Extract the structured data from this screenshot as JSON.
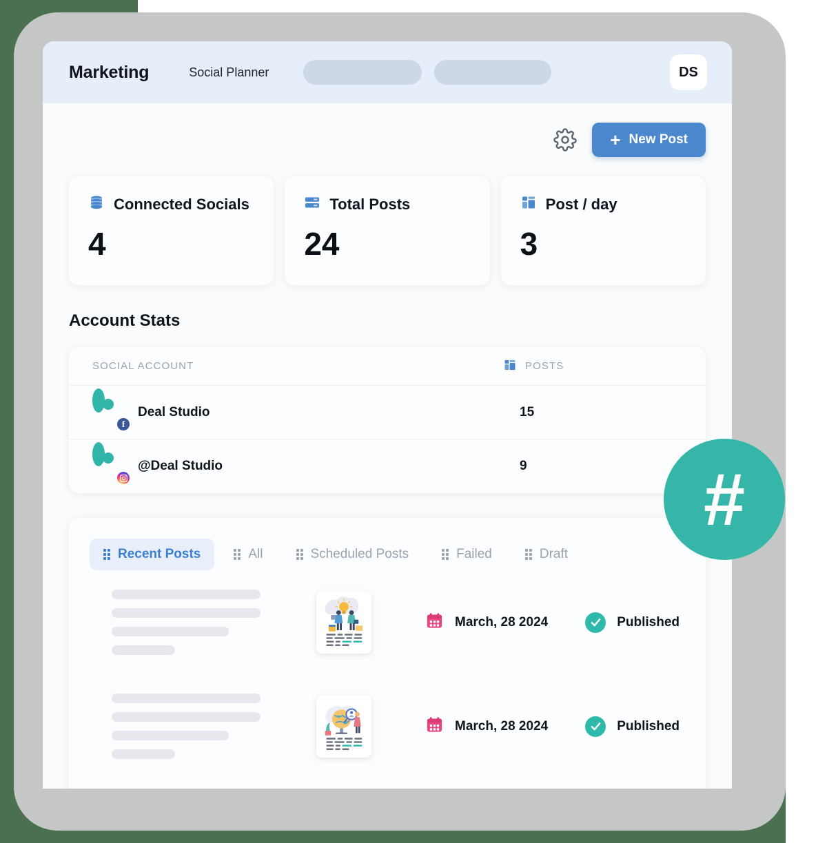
{
  "header": {
    "brand": "Marketing",
    "subtitle": "Social Planner",
    "avatar_initials": "DS"
  },
  "toolbar": {
    "settings_icon": "gear-icon",
    "new_post_label": "New Post",
    "plus_glyph": "+"
  },
  "stats": [
    {
      "icon": "database-icon",
      "title": "Connected Socials",
      "value": "4"
    },
    {
      "icon": "server-icon",
      "title": "Total Posts",
      "value": "24"
    },
    {
      "icon": "layout-icon",
      "title": "Post / day",
      "value": "3"
    }
  ],
  "account_stats": {
    "section_title": "Account Stats",
    "columns": {
      "account": "SOCIAL ACCOUNT",
      "posts": "POSTS"
    },
    "rows": [
      {
        "name": "Deal Studio",
        "network": "facebook",
        "badge_glyph": "f",
        "posts": "15"
      },
      {
        "name": "@Deal Studio",
        "network": "instagram",
        "badge_glyph": "",
        "posts": "9"
      }
    ]
  },
  "posts_panel": {
    "tabs": [
      {
        "label": "Recent Posts",
        "active": true
      },
      {
        "label": "All",
        "active": false
      },
      {
        "label": "Scheduled Posts",
        "active": false
      },
      {
        "label": "Failed",
        "active": false
      },
      {
        "label": "Draft",
        "active": false
      }
    ],
    "rows": [
      {
        "thumbnail": "lightbulb-teamwork-illustration",
        "date": "March, 28 2024",
        "status": "Published"
      },
      {
        "thumbnail": "globe-search-illustration",
        "date": "March, 28 2024",
        "status": "Published"
      }
    ]
  },
  "decoration": {
    "hashtag_glyph": "#"
  },
  "colors": {
    "accent_blue": "#4a87cc",
    "teal": "#30b5a8",
    "header_bg": "#e6eefa",
    "bezel": "#c4c7c5",
    "backdrop_green": "#4b7050",
    "calendar_pink": "#e8477f"
  }
}
